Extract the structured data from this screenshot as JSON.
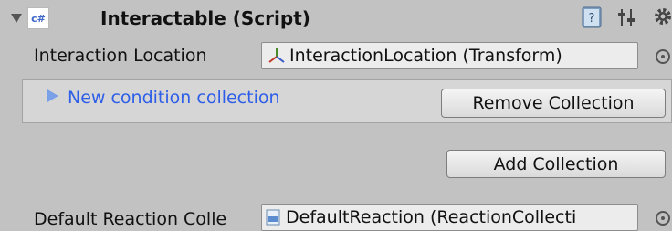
{
  "component": {
    "title": "Interactable (Script)",
    "script_badge": "c#"
  },
  "fields": {
    "interaction_location": {
      "label": "Interaction Location",
      "value": "InteractionLocation (Transform)"
    },
    "default_reaction": {
      "label": "Default Reaction Colle",
      "value": "DefaultReaction (ReactionCollecti"
    }
  },
  "conditions": {
    "collection_label": "New condition collection",
    "remove_button": "Remove Collection",
    "add_button": "Add Collection"
  },
  "colors": {
    "background": "#c2c2c2",
    "foldout_blue": "#2e5ee8",
    "field_bg": "#ececec"
  },
  "icons": {
    "foldout": "triangle-down-icon",
    "script": "csharp-script-icon",
    "help": "help-book-icon",
    "presets": "sliders-icon",
    "settings": "gear-icon",
    "transform": "transform-axes-icon",
    "reaction_asset": "asset-file-icon",
    "object_picker": "object-picker-icon"
  }
}
